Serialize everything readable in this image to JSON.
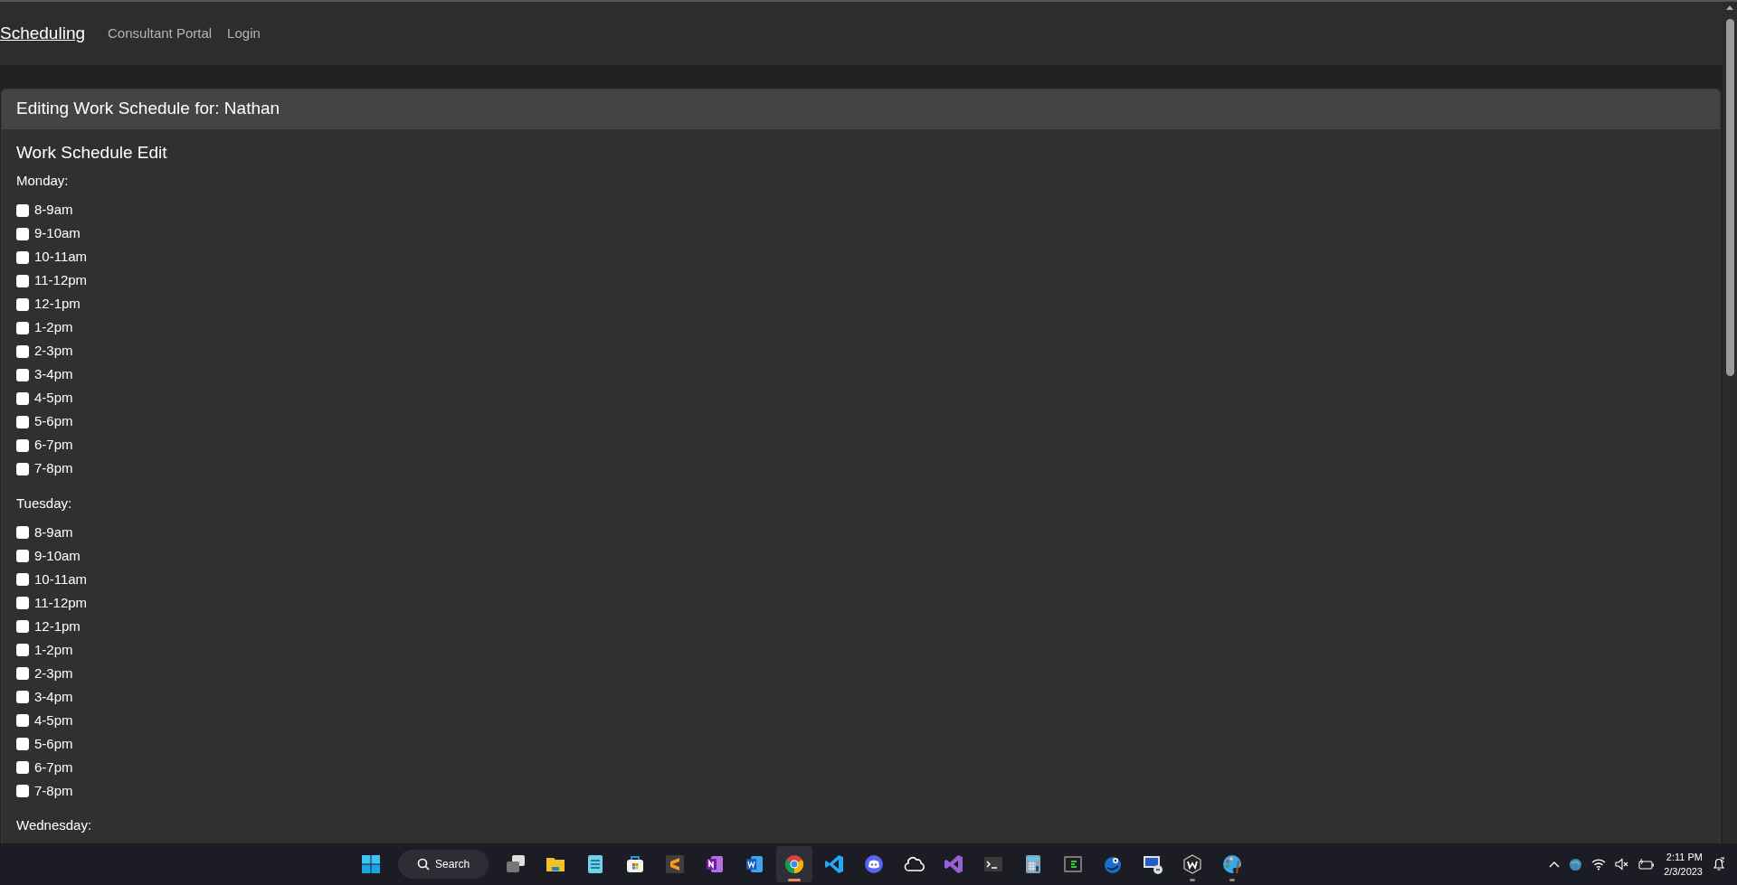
{
  "navbar": {
    "brand": "Scheduling",
    "links": [
      {
        "label": "Consultant Portal"
      },
      {
        "label": "Login"
      }
    ]
  },
  "card": {
    "header": "Editing Work Schedule for: Nathan",
    "title": "Work Schedule Edit",
    "days": [
      {
        "label": "Monday:",
        "slots": [
          {
            "label": "8-9am",
            "checked": false
          },
          {
            "label": "9-10am",
            "checked": false
          },
          {
            "label": "10-11am",
            "checked": false
          },
          {
            "label": "11-12pm",
            "checked": false
          },
          {
            "label": "12-1pm",
            "checked": false
          },
          {
            "label": "1-2pm",
            "checked": false
          },
          {
            "label": "2-3pm",
            "checked": false
          },
          {
            "label": "3-4pm",
            "checked": false
          },
          {
            "label": "4-5pm",
            "checked": false
          },
          {
            "label": "5-6pm",
            "checked": false
          },
          {
            "label": "6-7pm",
            "checked": false
          },
          {
            "label": "7-8pm",
            "checked": false
          }
        ]
      },
      {
        "label": "Tuesday:",
        "slots": [
          {
            "label": "8-9am",
            "checked": false
          },
          {
            "label": "9-10am",
            "checked": false
          },
          {
            "label": "10-11am",
            "checked": false
          },
          {
            "label": "11-12pm",
            "checked": false
          },
          {
            "label": "12-1pm",
            "checked": false
          },
          {
            "label": "1-2pm",
            "checked": false
          },
          {
            "label": "2-3pm",
            "checked": false
          },
          {
            "label": "3-4pm",
            "checked": false
          },
          {
            "label": "4-5pm",
            "checked": false
          },
          {
            "label": "5-6pm",
            "checked": false
          },
          {
            "label": "6-7pm",
            "checked": false
          },
          {
            "label": "7-8pm",
            "checked": false
          }
        ]
      },
      {
        "label": "Wednesday:"
      }
    ]
  },
  "taskbar": {
    "search": "Search",
    "apps": [
      {
        "kind": "taskview",
        "active": false,
        "running": false
      },
      {
        "kind": "folder",
        "active": false,
        "running": false
      },
      {
        "kind": "notepad",
        "active": false,
        "running": false
      },
      {
        "kind": "store",
        "active": false,
        "running": false
      },
      {
        "kind": "sublime",
        "active": false,
        "running": false
      },
      {
        "kind": "onenote",
        "active": false,
        "running": false
      },
      {
        "kind": "word",
        "active": false,
        "running": false
      },
      {
        "kind": "chrome",
        "active": true,
        "running": true
      },
      {
        "kind": "vscode",
        "active": false,
        "running": false
      },
      {
        "kind": "discord",
        "active": false,
        "running": false
      },
      {
        "kind": "cloud",
        "active": false,
        "running": false
      },
      {
        "kind": "vs",
        "active": false,
        "running": false
      },
      {
        "kind": "terminal",
        "active": false,
        "running": false
      },
      {
        "kind": "calculator",
        "active": false,
        "running": false
      },
      {
        "kind": "console",
        "active": false,
        "running": false
      },
      {
        "kind": "chameleon",
        "active": false,
        "running": false
      },
      {
        "kind": "remote",
        "active": false,
        "running": false
      },
      {
        "kind": "wbadge",
        "active": false,
        "running": true
      },
      {
        "kind": "palette",
        "active": false,
        "running": true
      }
    ],
    "time": "2:11 PM",
    "date": "2/3/2023"
  }
}
